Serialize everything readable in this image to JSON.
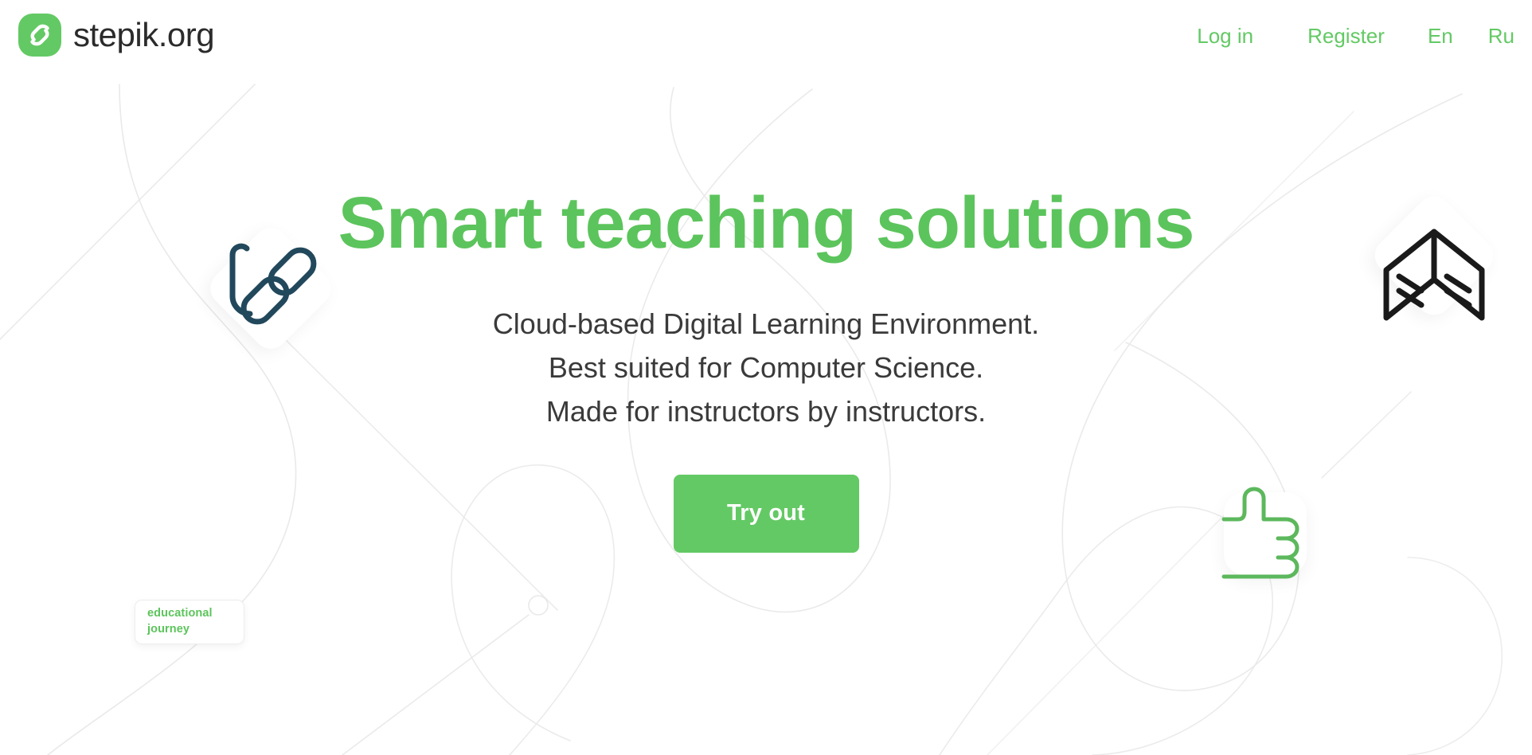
{
  "header": {
    "brand": {
      "logo_icon": "stepik-logo-icon",
      "text": "stepik.org"
    },
    "nav": [
      {
        "id": "login",
        "label": "Log in"
      },
      {
        "id": "register",
        "label": "Register"
      },
      {
        "id": "en",
        "label": "En"
      },
      {
        "id": "ru",
        "label": "Ru"
      }
    ]
  },
  "hero": {
    "title": "Smart teaching solutions",
    "subtitle_lines": [
      "Cloud-based Digital Learning Environment.",
      "Best suited for Computer Science.",
      "Made for instructors by instructors."
    ],
    "cta_label": "Try out"
  },
  "badge": {
    "line1": "educational",
    "line2": "journey"
  },
  "decorations": {
    "pen_icon": "pen-bookmark-icon",
    "book_icon": "open-book-icon",
    "thumb_icon": "thumbs-up-icon",
    "node_icon": "rounded-node-icon"
  },
  "colors": {
    "brand_green": "#63c964",
    "title_green": "#5cc45c",
    "button_green": "#63c964",
    "text_dark": "#3a3a3a",
    "brand_text": "#2b2b2b",
    "icon_navy": "#22485c",
    "icon_black": "#1a1a1a",
    "icon_green": "#5cb85c",
    "line_gray": "#e6e6e6",
    "background": "#ffffff"
  }
}
